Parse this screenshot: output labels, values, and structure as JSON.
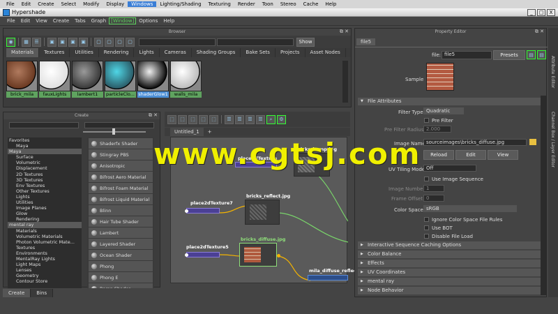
{
  "app_menu": [
    "File",
    "Edit",
    "Create",
    "Select",
    "Modify",
    "Display",
    "Windows",
    "Lighting/Shading",
    "Texturing",
    "Render",
    "Toon",
    "Stereo",
    "Cache",
    "Help"
  ],
  "app_menu_active": "Windows",
  "window": {
    "title": "Hypershade",
    "buttons": [
      "_",
      "□",
      "X"
    ]
  },
  "hs_menu": [
    "File",
    "Edit",
    "View",
    "Create",
    "Tabs",
    "Graph",
    "[Window]",
    "Options",
    "Help"
  ],
  "browser": {
    "header": "Browser",
    "show_button": "Show",
    "tabs": [
      "Materials",
      "Textures",
      "Utilities",
      "Rendering",
      "Lights",
      "Cameras",
      "Shading Groups",
      "Bake Sets",
      "Projects",
      "Asset Nodes"
    ],
    "active_tab": "Materials",
    "swatches": [
      {
        "label": "brick_mila",
        "colors": [
          "#b07a5e",
          "#6b3a22"
        ]
      },
      {
        "label": "fauxLights",
        "colors": [
          "#ffffff",
          "#e0e0e0"
        ]
      },
      {
        "label": "lambert1",
        "colors": [
          "#9a9a9a",
          "#3a3a3a"
        ]
      },
      {
        "label": "particleClo...",
        "colors": [
          "#4fd6e6",
          "#2b5e6a"
        ]
      },
      {
        "label": "shaderGlow1",
        "colors": [
          "#eeeeee",
          "#111111"
        ]
      },
      {
        "label": "walls_mila",
        "colors": [
          "#ffffff",
          "#bdbdbd"
        ]
      }
    ]
  },
  "create": {
    "header": "Create",
    "tree": [
      {
        "label": "Favorites",
        "level": "cat"
      },
      {
        "label": "Maya",
        "level": "sub"
      },
      {
        "label": "Maya",
        "level": "cat",
        "selected": true
      },
      {
        "label": "Surface",
        "level": "sub"
      },
      {
        "label": "Volumetric",
        "level": "sub"
      },
      {
        "label": "Displacement",
        "level": "sub"
      },
      {
        "label": "2D Textures",
        "level": "sub"
      },
      {
        "label": "3D Textures",
        "level": "sub"
      },
      {
        "label": "Env Textures",
        "level": "sub"
      },
      {
        "label": "Other Textures",
        "level": "sub"
      },
      {
        "label": "Lights",
        "level": "sub"
      },
      {
        "label": "Utilities",
        "level": "sub"
      },
      {
        "label": "Image Planes",
        "level": "sub"
      },
      {
        "label": "Glow",
        "level": "sub"
      },
      {
        "label": "Rendering",
        "level": "sub"
      },
      {
        "label": "mental ray",
        "level": "cat",
        "selected": true
      },
      {
        "label": "Materials",
        "level": "sub"
      },
      {
        "label": "Volumetric Materials",
        "level": "sub"
      },
      {
        "label": "Photon Volumetric Mate...",
        "level": "sub"
      },
      {
        "label": "Textures",
        "level": "sub"
      },
      {
        "label": "Environments",
        "level": "sub"
      },
      {
        "label": "MentalRay Lights",
        "level": "sub"
      },
      {
        "label": "Light Maps",
        "level": "sub"
      },
      {
        "label": "Lenses",
        "level": "sub"
      },
      {
        "label": "Geometry",
        "level": "sub"
      },
      {
        "label": "Contour Store",
        "level": "sub"
      }
    ],
    "shaders": [
      "Shaderfx Shader",
      "Stingray PBS",
      "Anisotropic",
      "Bifrost Aero Material",
      "Bifrost Foam Material",
      "Bifrost Liquid Material",
      "Blinn",
      "Hair Tube Shader",
      "Lambert",
      "Layered Shader",
      "Ocean Shader",
      "Phong",
      "Phong E",
      "Ramp Shader"
    ],
    "bottom_tabs": [
      "Create",
      "Bins"
    ]
  },
  "graph": {
    "tab": "Untitled_1",
    "plus": "+",
    "nodes": {
      "place2dTexture_top": "place2dTexture",
      "bricks_bump": "bricks_bump.jpg",
      "place2dTexture7": "place2dTexture7",
      "bricks_reflect": "bricks_reflect.jpg",
      "place2dTexture5": "place2dTexture5",
      "bricks_diffuse": "bricks_diffuse.jpg",
      "mila_diffuse": "mila_diffuse_reflect"
    }
  },
  "property": {
    "header": "Property Editor",
    "tab": "file5",
    "file_label": "file:",
    "file_value": "file5",
    "presets": "Presets",
    "sample": "Sample",
    "section_open": "File Attributes",
    "filter_type_label": "Filter Type",
    "filter_type": "Quadratic",
    "pre_filter": "Pre Filter",
    "pre_filter_radius_label": "Pre Filter Radius",
    "pre_filter_radius": "2.000",
    "image_name_label": "Image Name",
    "image_name": "sourceimages\\bricks_diffuse.jpg",
    "buttons": [
      "Reload",
      "Edit",
      "View"
    ],
    "uv_tiling_label": "UV Tiling Mode",
    "uv_tiling": "Off",
    "use_image_sequence": "Use Image Sequence",
    "image_number_label": "Image Number",
    "image_number": "1",
    "frame_offset_label": "Frame Offset",
    "frame_offset": "0",
    "color_space_label": "Color Space",
    "color_space": "sRGB",
    "ignore_rules": "Ignore Color Space File Rules",
    "use_bot": "Use BOT",
    "disable_file_load": "Disable File Load",
    "sections": [
      "Interactive Sequence Caching Options",
      "Color Balance",
      "Effects",
      "UV Coordinates",
      "mental ray",
      "Node Behavior"
    ]
  },
  "side_tabs": [
    "Attribute Editor",
    "Channel Box / Layer Editor"
  ],
  "watermark": "www.cgtsj.com"
}
